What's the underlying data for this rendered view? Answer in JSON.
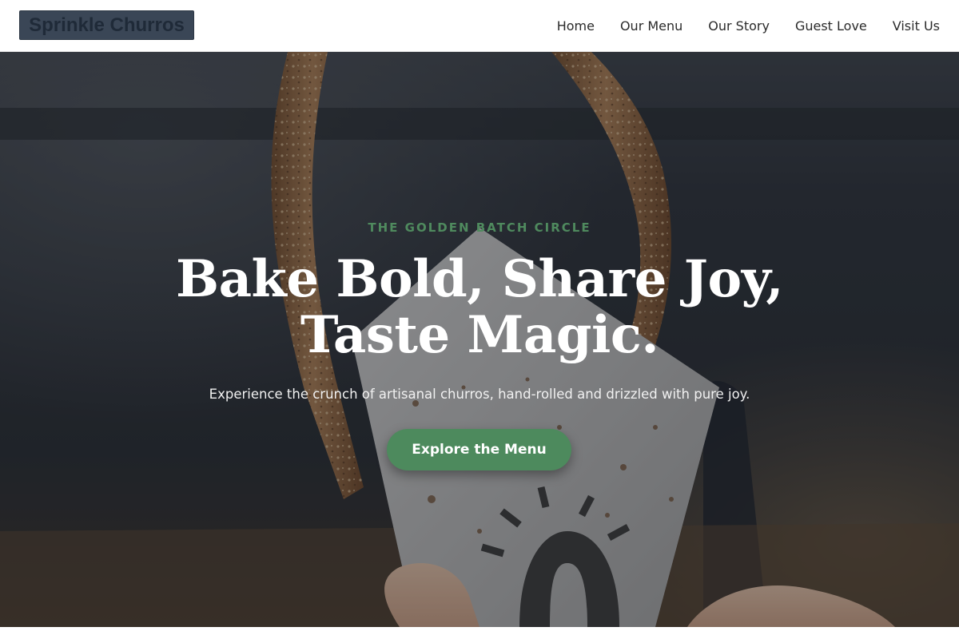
{
  "header": {
    "logo_text": "Sprinkle Churros",
    "nav": [
      {
        "label": "Home"
      },
      {
        "label": "Our Menu"
      },
      {
        "label": "Our Story"
      },
      {
        "label": "Guest Love"
      },
      {
        "label": "Visit Us"
      }
    ]
  },
  "hero": {
    "eyebrow": "THE GOLDEN BATCH CIRCLE",
    "headline_line1": "Bake Bold, Share Joy,",
    "headline_line2": "Taste Magic.",
    "subtitle": "Experience the crunch of artisanal churros, hand-rolled and drizzled with pure joy.",
    "cta_label": "Explore the Menu",
    "background_image": "churro-in-paper-cone-photo"
  },
  "colors": {
    "accent_green": "#4d8a5d",
    "logo_box": "#3a4656",
    "header_bg": "#ffffff",
    "headline": "#ffffff"
  }
}
